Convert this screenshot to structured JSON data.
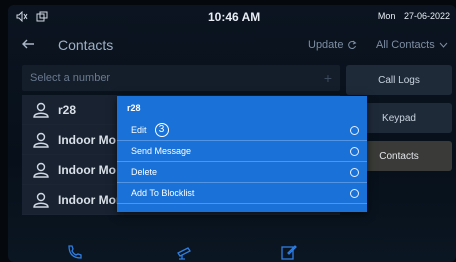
{
  "status": {
    "time": "10:46 AM",
    "day": "Mon",
    "date": "27-06-2022",
    "icons": [
      "speaker-icon",
      "window-icon"
    ]
  },
  "header": {
    "title": "Contacts",
    "update_label": "Update",
    "filter_label": "All Contacts"
  },
  "search": {
    "placeholder": "Select a number"
  },
  "nav": [
    {
      "label": "Call Logs",
      "active": false
    },
    {
      "label": "Keypad",
      "active": false
    },
    {
      "label": "Contacts",
      "active": true
    }
  ],
  "contacts": [
    {
      "name": "r28"
    },
    {
      "name": "Indoor Mo"
    },
    {
      "name": "Indoor Mo"
    },
    {
      "name": "Indoor Monitor"
    }
  ],
  "menu": {
    "title": "r28",
    "step_marker": "3",
    "items": [
      {
        "label": "Edit"
      },
      {
        "label": "Send Message"
      },
      {
        "label": "Delete"
      },
      {
        "label": "Add To Blocklist"
      }
    ]
  },
  "toolbar": {
    "icons": [
      "phone-icon",
      "camera-icon",
      "edit-icon"
    ]
  },
  "colors": {
    "menu": "#1a72d8",
    "background": "#0b1420",
    "active_tab": "#3a3b38"
  }
}
